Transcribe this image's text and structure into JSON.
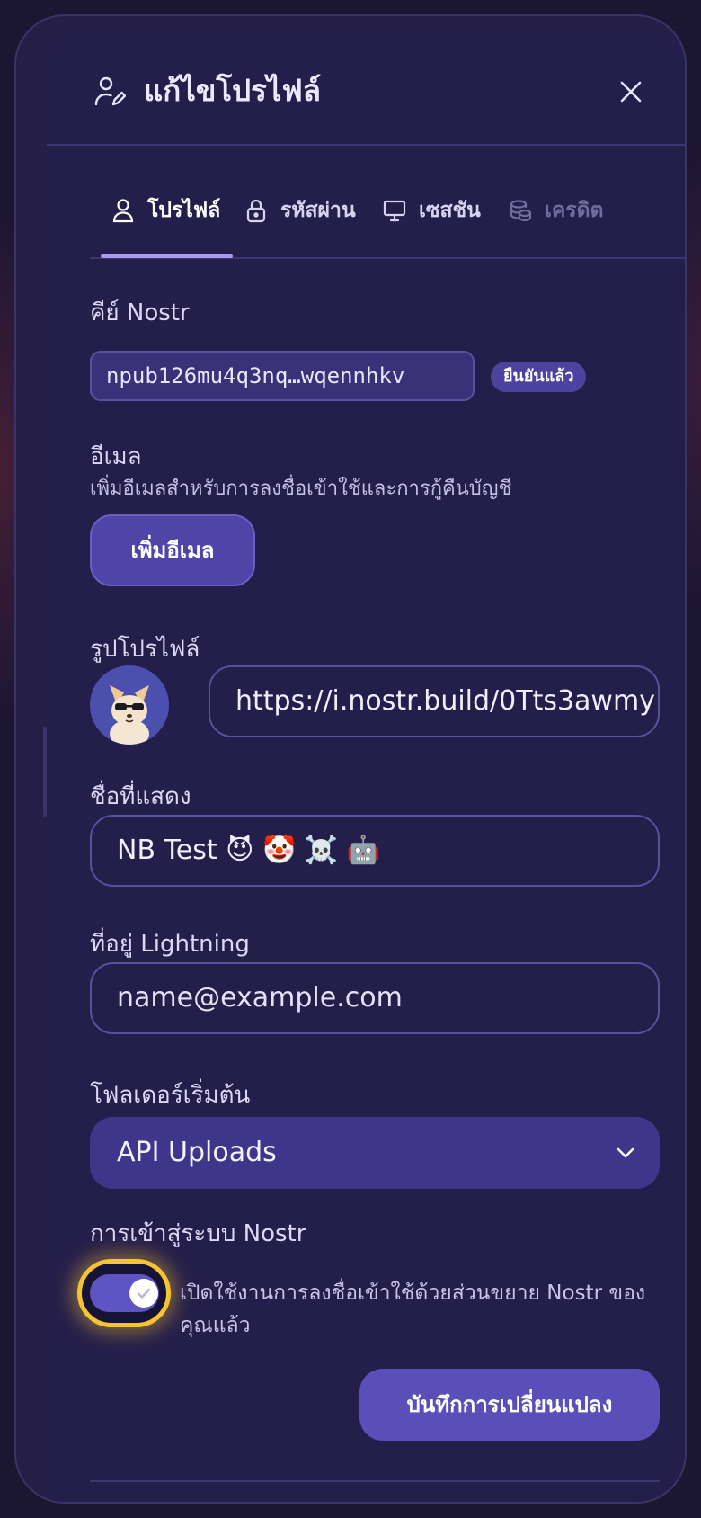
{
  "header": {
    "title": "แก้ไขโปรไฟล์",
    "icon": "user-edit-icon",
    "close_icon": "close-icon"
  },
  "tabs": [
    {
      "label": "โปรไฟล์",
      "icon": "user-icon",
      "active": true
    },
    {
      "label": "รหัสผ่าน",
      "icon": "lock-icon",
      "active": false
    },
    {
      "label": "เซสชัน",
      "icon": "monitor-icon",
      "active": false
    },
    {
      "label": "เครดิต",
      "icon": "coins-icon",
      "active": false
    }
  ],
  "nostr_key": {
    "label": "คีย์ Nostr",
    "value": "npub126mu4q3nq…wqennhkv",
    "badge": "ยืนยันแล้ว"
  },
  "email": {
    "label": "อีเมล",
    "description": "เพิ่มอีเมลสำหรับการลงชื่อเข้าใช้และการกู้คืนบัญชี",
    "add_button": "เพิ่มอีเมล"
  },
  "profile_picture": {
    "label": "รูปโปรไฟล์",
    "url": "https://i.nostr.build/0Tts3awmy"
  },
  "display_name": {
    "label": "ชื่อที่แสดง",
    "value": "NB Test 😈 🤡 ☠️ 🤖"
  },
  "lightning": {
    "label": "ที่อยู่ Lightning",
    "placeholder": "name@example.com"
  },
  "default_folder": {
    "label": "โฟลเดอร์เริ่มต้น",
    "selected": "API Uploads"
  },
  "nostr_login": {
    "label": "การเข้าสู่ระบบ Nostr",
    "enabled": true,
    "description": "เปิดใช้งานการลงชื่อเข้าใช้ด้วยส่วนขยาย Nostr ของคุณแล้ว"
  },
  "save_button": "บันทึกการเปลี่ยนแปลง",
  "colors": {
    "panel": "#241e4a",
    "accent": "#5a4fb8",
    "focus_ring": "#f6c431",
    "text": "#ece9ff"
  }
}
